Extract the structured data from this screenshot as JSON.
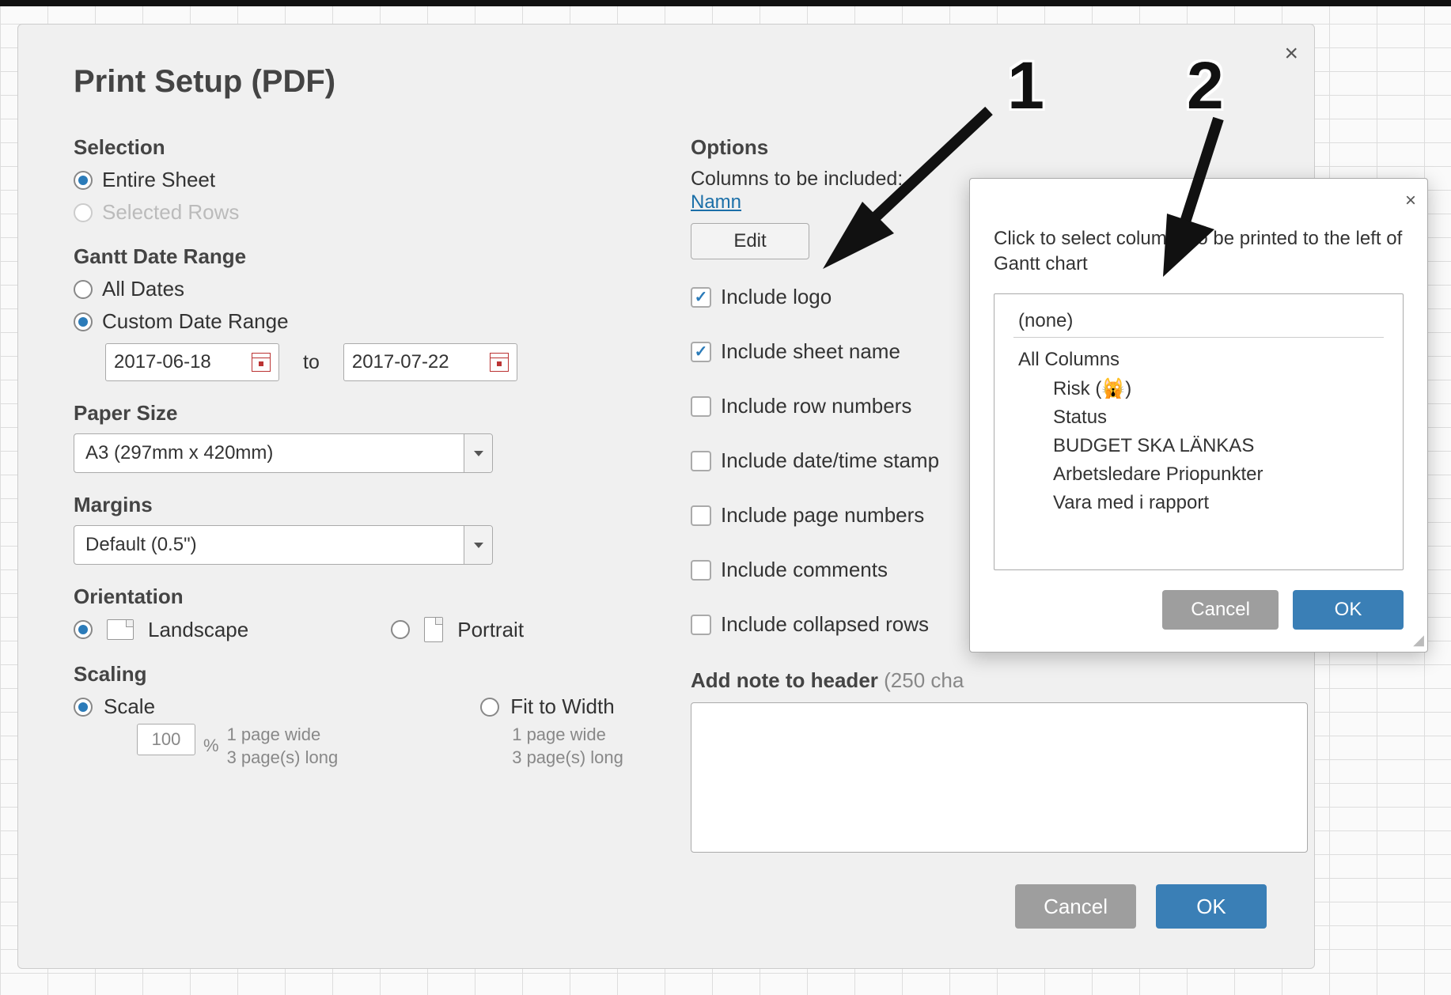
{
  "dialog": {
    "title": "Print Setup (PDF)",
    "close_aria": "Close",
    "selection": {
      "heading": "Selection",
      "entire_sheet": "Entire Sheet",
      "selected_rows": "Selected Rows"
    },
    "gantt_range": {
      "heading": "Gantt Date Range",
      "all_dates": "All Dates",
      "custom": "Custom Date Range",
      "from_date": "2017-06-18",
      "to_label": "to",
      "to_date": "2017-07-22"
    },
    "paper_size": {
      "heading": "Paper Size",
      "value": "A3 (297mm x 420mm)"
    },
    "margins": {
      "heading": "Margins",
      "value": "Default (0.5\")"
    },
    "orientation": {
      "heading": "Orientation",
      "landscape": "Landscape",
      "portrait": "Portrait"
    },
    "scaling": {
      "heading": "Scaling",
      "scale_label": "Scale",
      "scale_value": "100",
      "percent": "%",
      "sub1": "1 page wide",
      "sub2": "3 page(s) long",
      "fit_label": "Fit to Width",
      "fit_sub1": "1 page wide",
      "fit_sub2": "3 page(s) long"
    },
    "options": {
      "heading": "Options",
      "columns_label": "Columns to be included:",
      "columns_link": "Namn",
      "edit_label": "Edit",
      "include_logo": "Include logo",
      "include_sheet_name": "Include sheet name",
      "include_row_numbers": "Include row numbers",
      "include_datetime": "Include date/time stamp",
      "include_page_numbers": "Include page numbers",
      "include_comments": "Include comments",
      "include_collapsed": "Include collapsed rows",
      "note_head": "Add note to header",
      "note_hint": "(250 cha",
      "note_value": ""
    },
    "buttons": {
      "cancel": "Cancel",
      "ok": "OK"
    }
  },
  "popup": {
    "close_aria": "Close",
    "description": "Click to select columns to be printed to the left of Gantt chart",
    "none_label": "(none)",
    "all_columns_label": "All Columns",
    "items": [
      "Risk (🙀)",
      "Status",
      "BUDGET SKA LÄNKAS",
      "Arbetsledare Priopunkter",
      "Vara med i rapport"
    ],
    "cancel": "Cancel",
    "ok": "OK"
  },
  "annotations": {
    "n1": "1",
    "n2": "2"
  }
}
